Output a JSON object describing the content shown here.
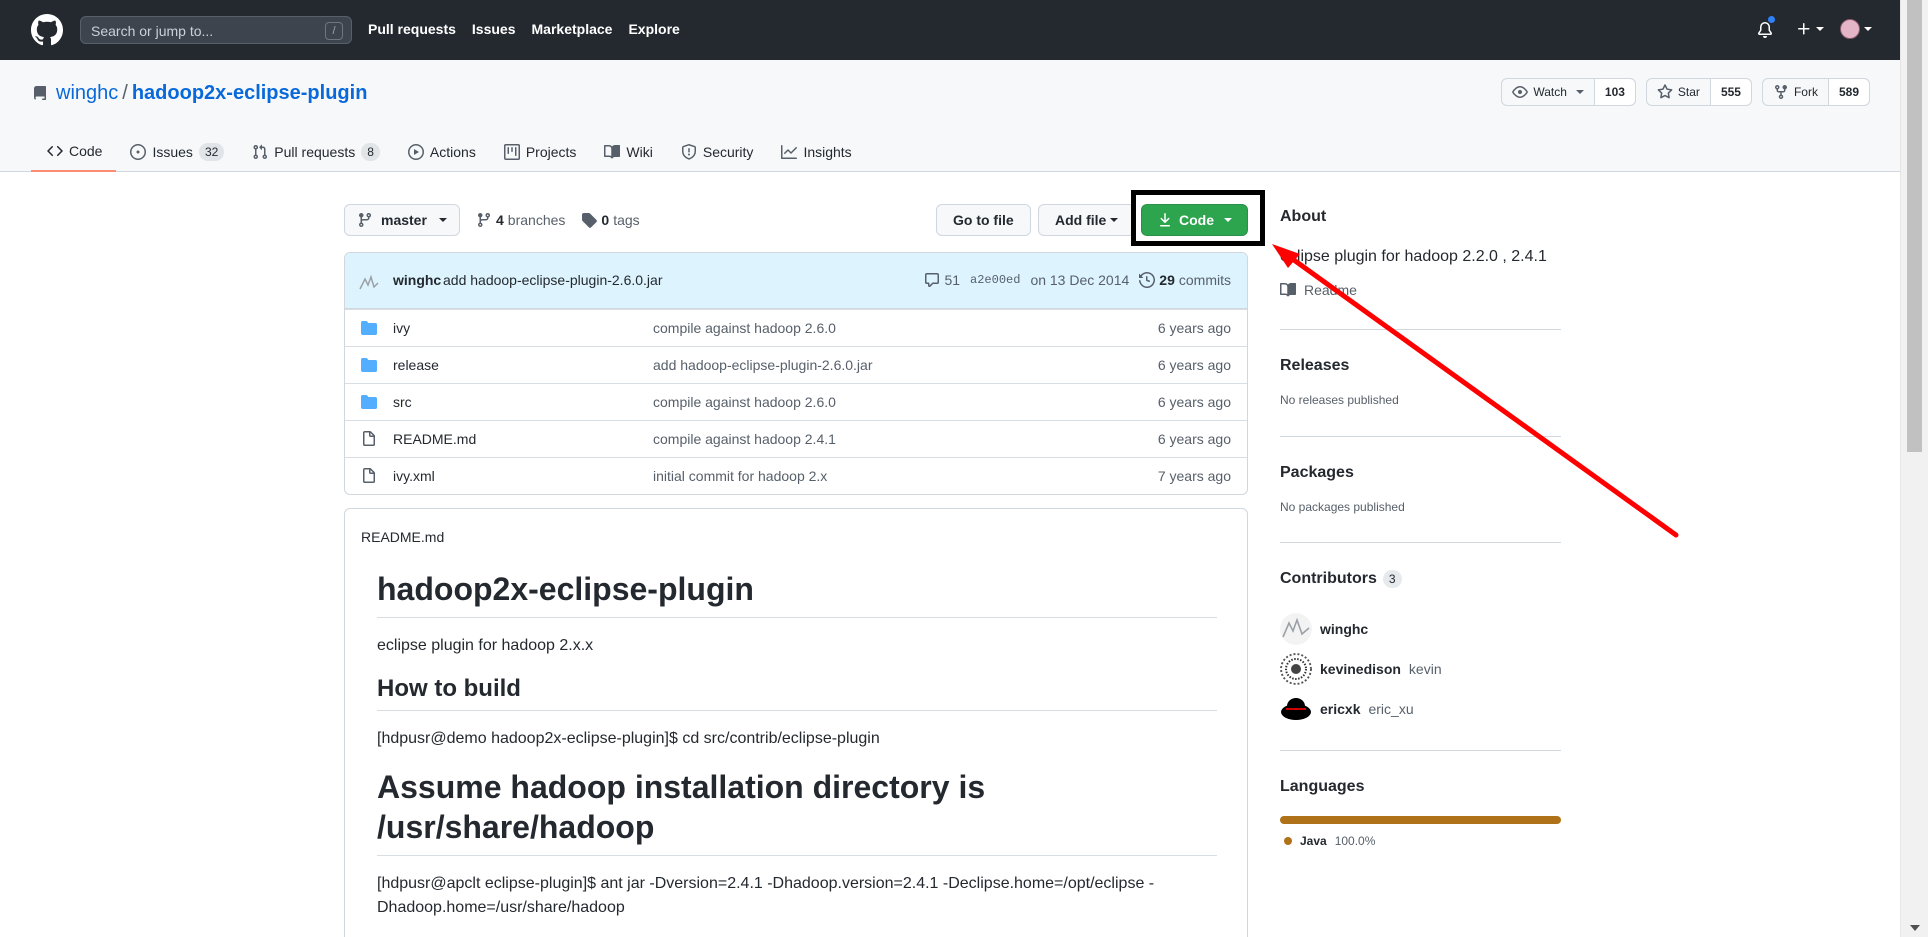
{
  "topbar": {
    "search_placeholder": "Search or jump to...",
    "search_key": "/",
    "nav": [
      "Pull requests",
      "Issues",
      "Marketplace",
      "Explore"
    ]
  },
  "repo": {
    "owner": "winghc",
    "separator": "/",
    "name": "hadoop2x-eclipse-plugin",
    "watch_label": "Watch",
    "watch_count": "103",
    "star_label": "Star",
    "star_count": "555",
    "fork_label": "Fork",
    "fork_count": "589"
  },
  "tabs": [
    {
      "label": "Code",
      "icon": "code-icon"
    },
    {
      "label": "Issues",
      "count": "32",
      "icon": "issue-icon"
    },
    {
      "label": "Pull requests",
      "count": "8",
      "icon": "pull-request-icon"
    },
    {
      "label": "Actions",
      "icon": "play-icon"
    },
    {
      "label": "Projects",
      "icon": "project-icon"
    },
    {
      "label": "Wiki",
      "icon": "book-icon"
    },
    {
      "label": "Security",
      "icon": "shield-icon"
    },
    {
      "label": "Insights",
      "icon": "graph-icon"
    }
  ],
  "toolbar": {
    "branch": "master",
    "branches_count": "4",
    "branches_label": "branches",
    "tags_count": "0",
    "tags_label": "tags",
    "goto_file": "Go to file",
    "add_file": "Add file",
    "code": "Code"
  },
  "commit": {
    "author": "winghc",
    "message": "add hadoop-eclipse-plugin-2.6.0.jar",
    "comments": "51",
    "sha": "a2e00ed",
    "date": "on 13 Dec 2014",
    "commits_count": "29",
    "commits_label": "commits"
  },
  "files": [
    {
      "type": "folder",
      "name": "ivy",
      "message": "compile against hadoop 2.6.0",
      "age": "6 years ago"
    },
    {
      "type": "folder",
      "name": "release",
      "message": "add hadoop-eclipse-plugin-2.6.0.jar",
      "age": "6 years ago"
    },
    {
      "type": "folder",
      "name": "src",
      "message": "compile against hadoop 2.6.0",
      "age": "6 years ago"
    },
    {
      "type": "file",
      "name": "README.md",
      "message": "compile against hadoop 2.4.1",
      "age": "6 years ago"
    },
    {
      "type": "file",
      "name": "ivy.xml",
      "message": "initial commit for hadoop 2.x",
      "age": "7 years ago"
    }
  ],
  "readme": {
    "filename": "README.md",
    "h1": "hadoop2x-eclipse-plugin",
    "p1": "eclipse plugin for hadoop 2.x.x",
    "h2": "How to build",
    "p2": "[hdpusr@demo hadoop2x-eclipse-plugin]$ cd src/contrib/eclipse-plugin",
    "h1b": "Assume hadoop installation directory is /usr/share/hadoop",
    "p3": "[hdpusr@apclt eclipse-plugin]$ ant jar -Dversion=2.4.1 -Dhadoop.version=2.4.1 -Declipse.home=/opt/eclipse -Dhadoop.home=/usr/share/hadoop"
  },
  "sidebar": {
    "about_title": "About",
    "about_desc": "eclipse plugin for hadoop 2.2.0 , 2.4.1",
    "readme_link": "Readme",
    "releases_title": "Releases",
    "releases_note": "No releases published",
    "packages_title": "Packages",
    "packages_note": "No packages published",
    "contributors_title": "Contributors",
    "contributors_count": "3",
    "contributors": [
      {
        "login": "winghc",
        "name": ""
      },
      {
        "login": "kevinedison",
        "name": "kevin"
      },
      {
        "login": "ericxk",
        "name": "eric_xu"
      }
    ],
    "languages_title": "Languages",
    "language": "Java",
    "language_pct": "100.0%",
    "language_color": "#b07219"
  },
  "colors": {
    "code_button": "#2da44e",
    "link": "#0969da",
    "annotation_arrow": "#ff0000"
  }
}
